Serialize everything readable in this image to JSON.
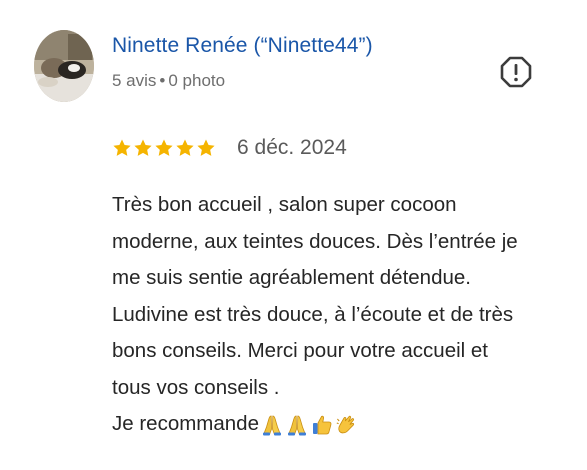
{
  "author": {
    "name": "Ninette Renée (“Ninette44”)",
    "reviews_count": "5 avis",
    "separator": "•",
    "photos_count": "0 photo"
  },
  "rating": {
    "stars": 5,
    "max_stars": 5,
    "star_color": "#f5b400",
    "date": "6 déc. 2024"
  },
  "review": {
    "lines": [
      "Très bon accueil , salon super cocoon",
      "moderne, aux teintes douces. Dès l’entrée je",
      "me suis sentie agréablement détendue.",
      "Ludivine est très douce, à l’écoute et de très",
      "bons conseils. Merci pour votre accueil et",
      "tous vos conseils ."
    ],
    "last_line": "Je recommande",
    "emojis": [
      "folded-hands",
      "folded-hands",
      "thumbs-up",
      "clapping-hands"
    ]
  },
  "actions": {
    "report_icon": "report-flag-icon"
  },
  "colors": {
    "name": "#1a56a8",
    "meta": "#6e6e6e",
    "text": "#262626"
  }
}
